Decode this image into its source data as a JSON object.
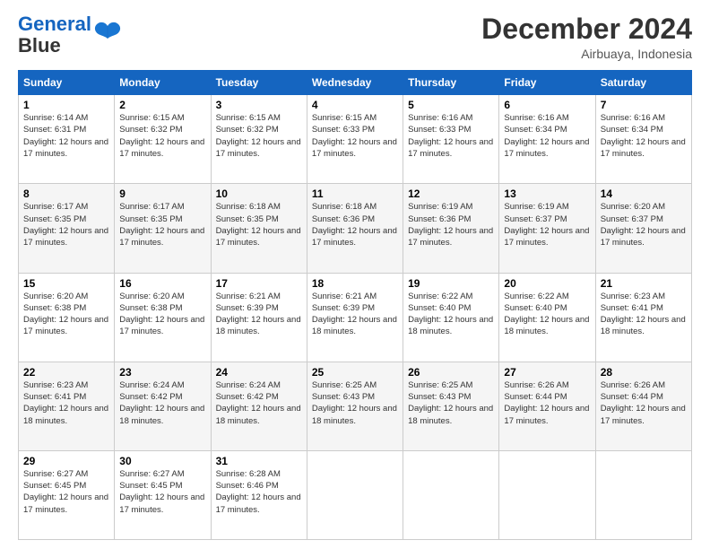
{
  "header": {
    "logo_line1": "General",
    "logo_line2": "Blue",
    "month": "December 2024",
    "location": "Airbuaya, Indonesia"
  },
  "days_of_week": [
    "Sunday",
    "Monday",
    "Tuesday",
    "Wednesday",
    "Thursday",
    "Friday",
    "Saturday"
  ],
  "weeks": [
    [
      {
        "day": 1,
        "sunrise": "6:14 AM",
        "sunset": "6:31 PM",
        "daylight": "12 hours and 17 minutes."
      },
      {
        "day": 2,
        "sunrise": "6:15 AM",
        "sunset": "6:32 PM",
        "daylight": "12 hours and 17 minutes."
      },
      {
        "day": 3,
        "sunrise": "6:15 AM",
        "sunset": "6:32 PM",
        "daylight": "12 hours and 17 minutes."
      },
      {
        "day": 4,
        "sunrise": "6:15 AM",
        "sunset": "6:33 PM",
        "daylight": "12 hours and 17 minutes."
      },
      {
        "day": 5,
        "sunrise": "6:16 AM",
        "sunset": "6:33 PM",
        "daylight": "12 hours and 17 minutes."
      },
      {
        "day": 6,
        "sunrise": "6:16 AM",
        "sunset": "6:34 PM",
        "daylight": "12 hours and 17 minutes."
      },
      {
        "day": 7,
        "sunrise": "6:16 AM",
        "sunset": "6:34 PM",
        "daylight": "12 hours and 17 minutes."
      }
    ],
    [
      {
        "day": 8,
        "sunrise": "6:17 AM",
        "sunset": "6:35 PM",
        "daylight": "12 hours and 17 minutes."
      },
      {
        "day": 9,
        "sunrise": "6:17 AM",
        "sunset": "6:35 PM",
        "daylight": "12 hours and 17 minutes."
      },
      {
        "day": 10,
        "sunrise": "6:18 AM",
        "sunset": "6:35 PM",
        "daylight": "12 hours and 17 minutes."
      },
      {
        "day": 11,
        "sunrise": "6:18 AM",
        "sunset": "6:36 PM",
        "daylight": "12 hours and 17 minutes."
      },
      {
        "day": 12,
        "sunrise": "6:19 AM",
        "sunset": "6:36 PM",
        "daylight": "12 hours and 17 minutes."
      },
      {
        "day": 13,
        "sunrise": "6:19 AM",
        "sunset": "6:37 PM",
        "daylight": "12 hours and 17 minutes."
      },
      {
        "day": 14,
        "sunrise": "6:20 AM",
        "sunset": "6:37 PM",
        "daylight": "12 hours and 17 minutes."
      }
    ],
    [
      {
        "day": 15,
        "sunrise": "6:20 AM",
        "sunset": "6:38 PM",
        "daylight": "12 hours and 17 minutes."
      },
      {
        "day": 16,
        "sunrise": "6:20 AM",
        "sunset": "6:38 PM",
        "daylight": "12 hours and 17 minutes."
      },
      {
        "day": 17,
        "sunrise": "6:21 AM",
        "sunset": "6:39 PM",
        "daylight": "12 hours and 18 minutes."
      },
      {
        "day": 18,
        "sunrise": "6:21 AM",
        "sunset": "6:39 PM",
        "daylight": "12 hours and 18 minutes."
      },
      {
        "day": 19,
        "sunrise": "6:22 AM",
        "sunset": "6:40 PM",
        "daylight": "12 hours and 18 minutes."
      },
      {
        "day": 20,
        "sunrise": "6:22 AM",
        "sunset": "6:40 PM",
        "daylight": "12 hours and 18 minutes."
      },
      {
        "day": 21,
        "sunrise": "6:23 AM",
        "sunset": "6:41 PM",
        "daylight": "12 hours and 18 minutes."
      }
    ],
    [
      {
        "day": 22,
        "sunrise": "6:23 AM",
        "sunset": "6:41 PM",
        "daylight": "12 hours and 18 minutes."
      },
      {
        "day": 23,
        "sunrise": "6:24 AM",
        "sunset": "6:42 PM",
        "daylight": "12 hours and 18 minutes."
      },
      {
        "day": 24,
        "sunrise": "6:24 AM",
        "sunset": "6:42 PM",
        "daylight": "12 hours and 18 minutes."
      },
      {
        "day": 25,
        "sunrise": "6:25 AM",
        "sunset": "6:43 PM",
        "daylight": "12 hours and 18 minutes."
      },
      {
        "day": 26,
        "sunrise": "6:25 AM",
        "sunset": "6:43 PM",
        "daylight": "12 hours and 18 minutes."
      },
      {
        "day": 27,
        "sunrise": "6:26 AM",
        "sunset": "6:44 PM",
        "daylight": "12 hours and 17 minutes."
      },
      {
        "day": 28,
        "sunrise": "6:26 AM",
        "sunset": "6:44 PM",
        "daylight": "12 hours and 17 minutes."
      }
    ],
    [
      {
        "day": 29,
        "sunrise": "6:27 AM",
        "sunset": "6:45 PM",
        "daylight": "12 hours and 17 minutes."
      },
      {
        "day": 30,
        "sunrise": "6:27 AM",
        "sunset": "6:45 PM",
        "daylight": "12 hours and 17 minutes."
      },
      {
        "day": 31,
        "sunrise": "6:28 AM",
        "sunset": "6:46 PM",
        "daylight": "12 hours and 17 minutes."
      },
      null,
      null,
      null,
      null
    ]
  ]
}
